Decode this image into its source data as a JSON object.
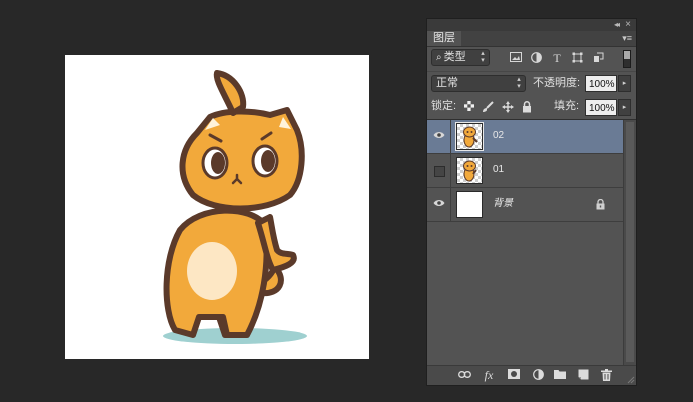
{
  "canvas": {
    "description_icon": "cat-illustration"
  },
  "panel": {
    "top_controls": {
      "collapse_icon": "double-chevron-icon",
      "close_icon": "close-icon"
    },
    "tab_label": "图层",
    "filter": {
      "search_glyph": "⌕",
      "kind_label": "类型",
      "icons": [
        "image-filter-icon",
        "adjustment-filter-icon",
        "type-filter-icon",
        "shape-filter-icon",
        "smart-object-filter-icon"
      ]
    },
    "blend_mode": "正常",
    "opacity_label": "不透明度:",
    "opacity_value": "100%",
    "lock_label": "锁定:",
    "fill_label": "填充:",
    "fill_value": "100%",
    "layers": [
      {
        "name": "02",
        "visible": true,
        "selected": true,
        "thumb": "cat"
      },
      {
        "name": "01",
        "visible": false,
        "selected": false,
        "thumb": "cat"
      },
      {
        "name": "背景",
        "visible": true,
        "selected": false,
        "thumb": "white",
        "locked": true
      }
    ],
    "bottom_icons": [
      "link-layers-icon",
      "fx-icon",
      "add-mask-icon",
      "adjustment-layer-icon",
      "new-group-icon",
      "new-layer-icon",
      "delete-layer-icon"
    ],
    "bottom_labels": {
      "fx": "fx"
    },
    "colors": {
      "panel_bg": "#535353",
      "selected_row": "#6a7b95",
      "app_bg": "#282828"
    }
  }
}
